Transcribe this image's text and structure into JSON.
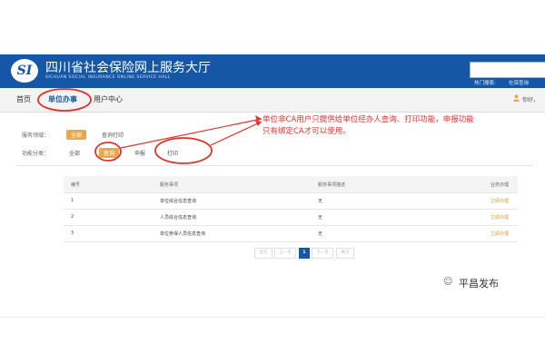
{
  "header": {
    "logo": "SI",
    "title": "四川省社会保险网上服务大厅",
    "subtitle": "SICHUAN SOCIAL INSURANCE ONLINE SERVICE HALL",
    "hot_label": "热门搜索:",
    "hot_link": "社保查询"
  },
  "nav": {
    "home": "首页",
    "unit_affairs": "单位办事",
    "user_center": "用户中心",
    "user_text": "你好，"
  },
  "filters": {
    "service_label": "服务领域：",
    "service_all": "全部",
    "service_query": "查询打印",
    "func_label": "功能分类：",
    "func_all": "全部",
    "func_query": "查询",
    "func_report": "申报",
    "func_print": "打印"
  },
  "table": {
    "headers": [
      "编号",
      "服务事项",
      "服务事项描述",
      "业务办理"
    ],
    "rows": [
      {
        "no": "1",
        "item": "单位综合信息查询",
        "desc": "无",
        "op": "立即办理"
      },
      {
        "no": "2",
        "item": "人员综合信息查询",
        "desc": "无",
        "op": "立即办理"
      },
      {
        "no": "3",
        "item": "单位参保人员信息查询",
        "desc": "无",
        "op": "立即办理"
      }
    ]
  },
  "pager": {
    "first": "首页",
    "prev": "上一页",
    "current": "1",
    "next": "下一页",
    "last": "尾页"
  },
  "annotation": {
    "line1": "单位非CA用户只提供给单位经办人查询、打印功能，申报功能",
    "line2": "只有绑定CA才可以使用。"
  },
  "watermark": "平昌发布",
  "colors": {
    "brand": "#1557a6",
    "accent": "#e8a84d",
    "annotation": "#e0322d"
  }
}
